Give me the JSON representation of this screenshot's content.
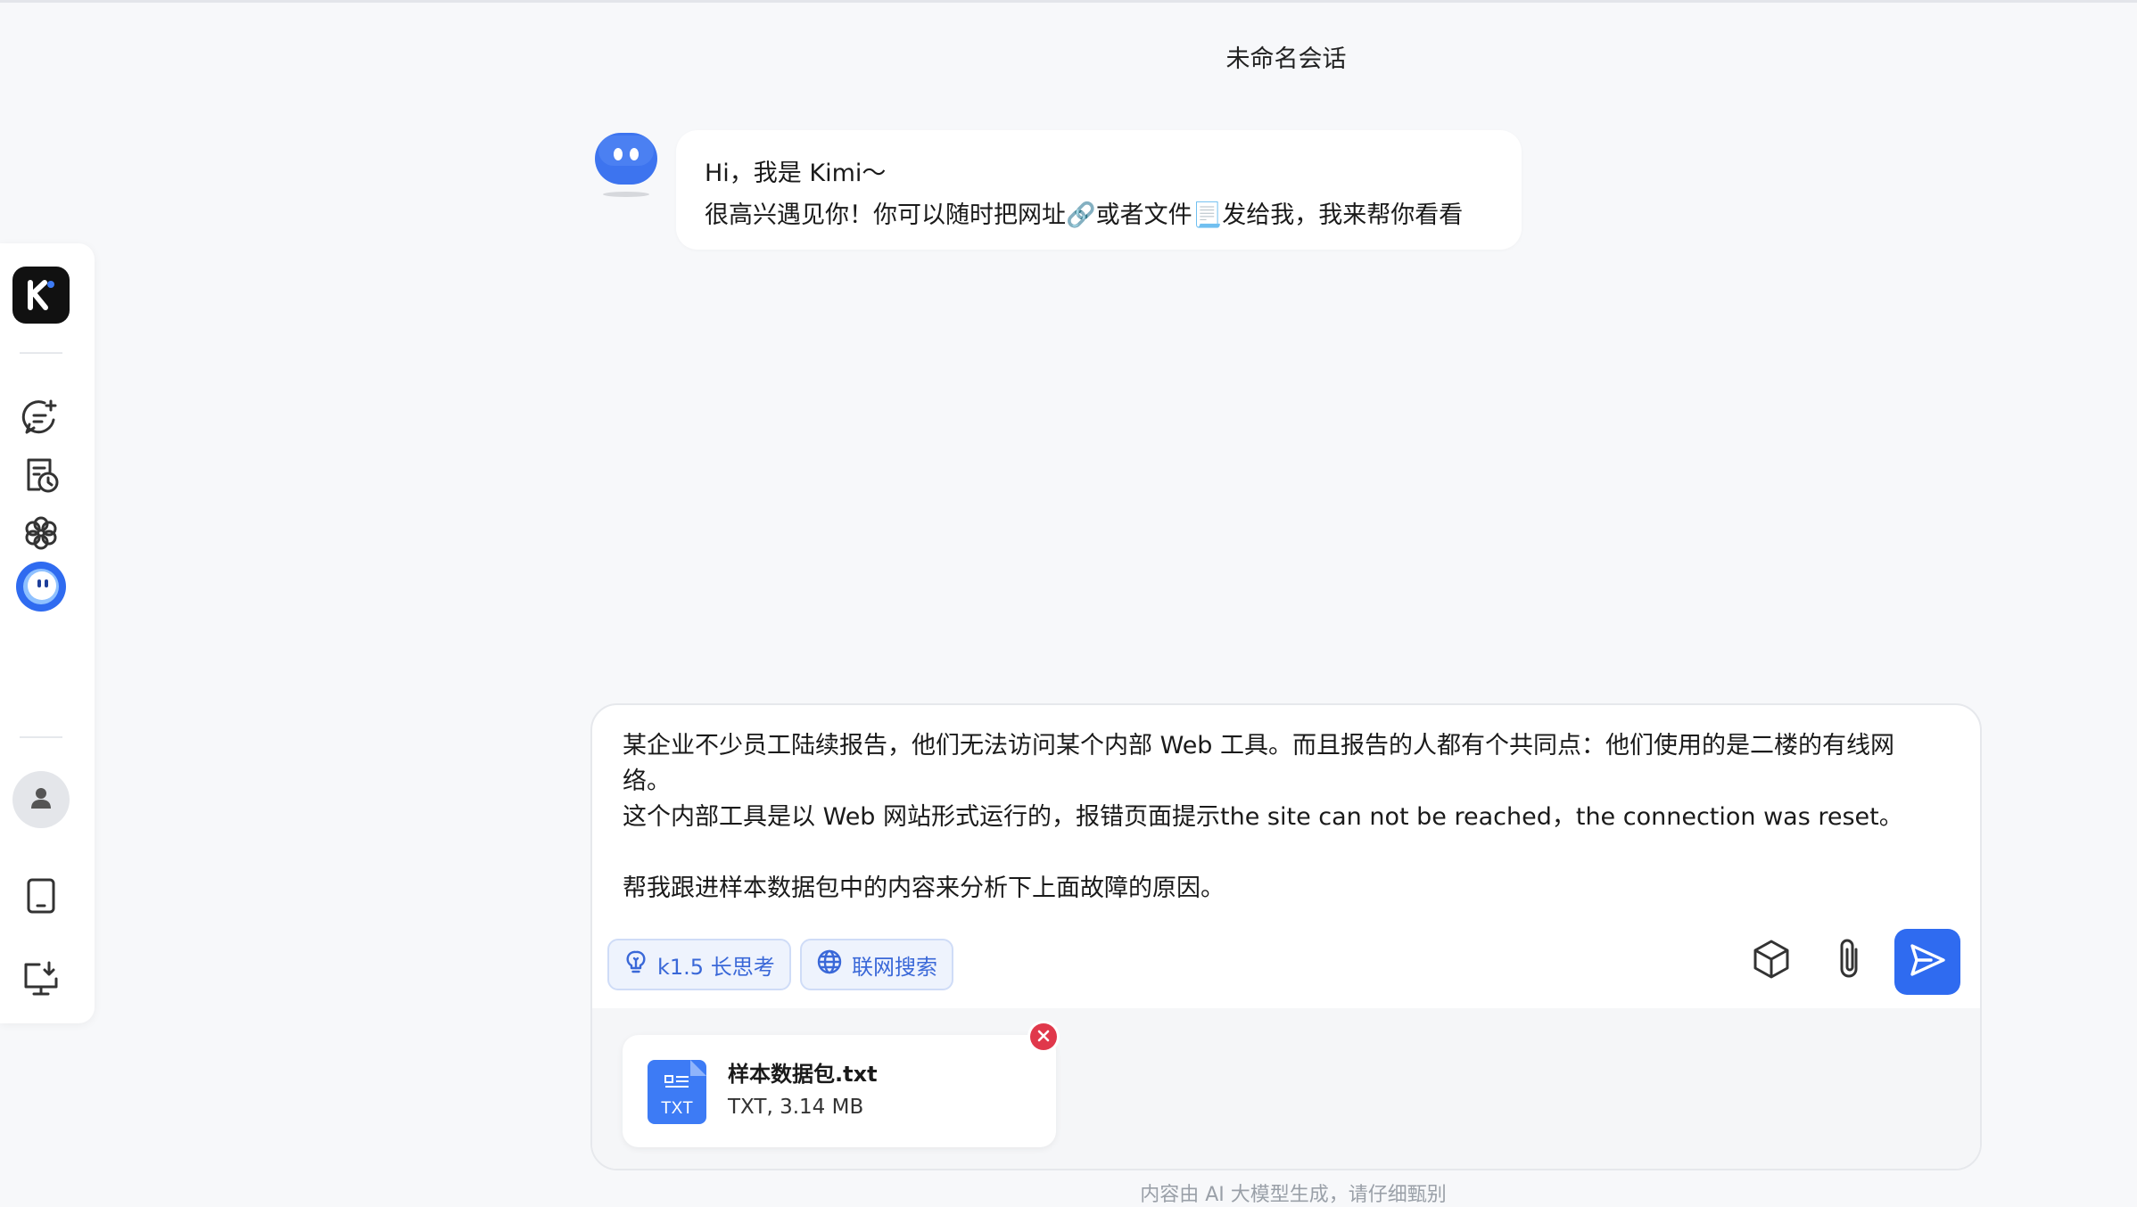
{
  "header": {
    "title": "未命名会话"
  },
  "sidebar": {
    "items": [
      {
        "name": "kimi-logo",
        "icon": "k-logo-icon"
      },
      {
        "name": "new-chat",
        "icon": "chat-plus-icon"
      },
      {
        "name": "history",
        "icon": "history-icon"
      },
      {
        "name": "explore",
        "icon": "flower-icon"
      },
      {
        "name": "kimi-assistant",
        "icon": "kimi-orb-icon"
      },
      {
        "name": "user",
        "icon": "user-icon"
      },
      {
        "name": "mobile-app",
        "icon": "tablet-icon"
      },
      {
        "name": "desktop-download",
        "icon": "monitor-download-icon"
      }
    ]
  },
  "greeting": {
    "line1": "Hi，我是 Kimi～",
    "line2": "很高兴遇见你！你可以随时把网址🔗或者文件📃发给我，我来帮你看看"
  },
  "composer": {
    "line1": "某企业不少员工陆续报告，他们无法访问某个内部 Web 工具。而且报告的人都有个共同点：他们使用的是二楼的有线网",
    "line2": "络。",
    "line3": "这个内部工具是以 Web 网站形式运行的，报错页面提示the site can not be reached，the connection was reset。",
    "line4": "",
    "line5": "帮我跟进样本数据包中的内容来分析下上面故障的原因。",
    "chip_thinking": "k1.5 长思考",
    "chip_search": "联网搜索"
  },
  "attachment": {
    "name": "样本数据包.txt",
    "meta": "TXT, 3.14 MB",
    "ext": "TXT"
  },
  "footer": {
    "note": "内容由 AI 大模型生成，请仔细甄别"
  },
  "colors": {
    "accent": "#2f6bf0",
    "chip_text": "#3a68d8",
    "remove": "#e0384b"
  }
}
